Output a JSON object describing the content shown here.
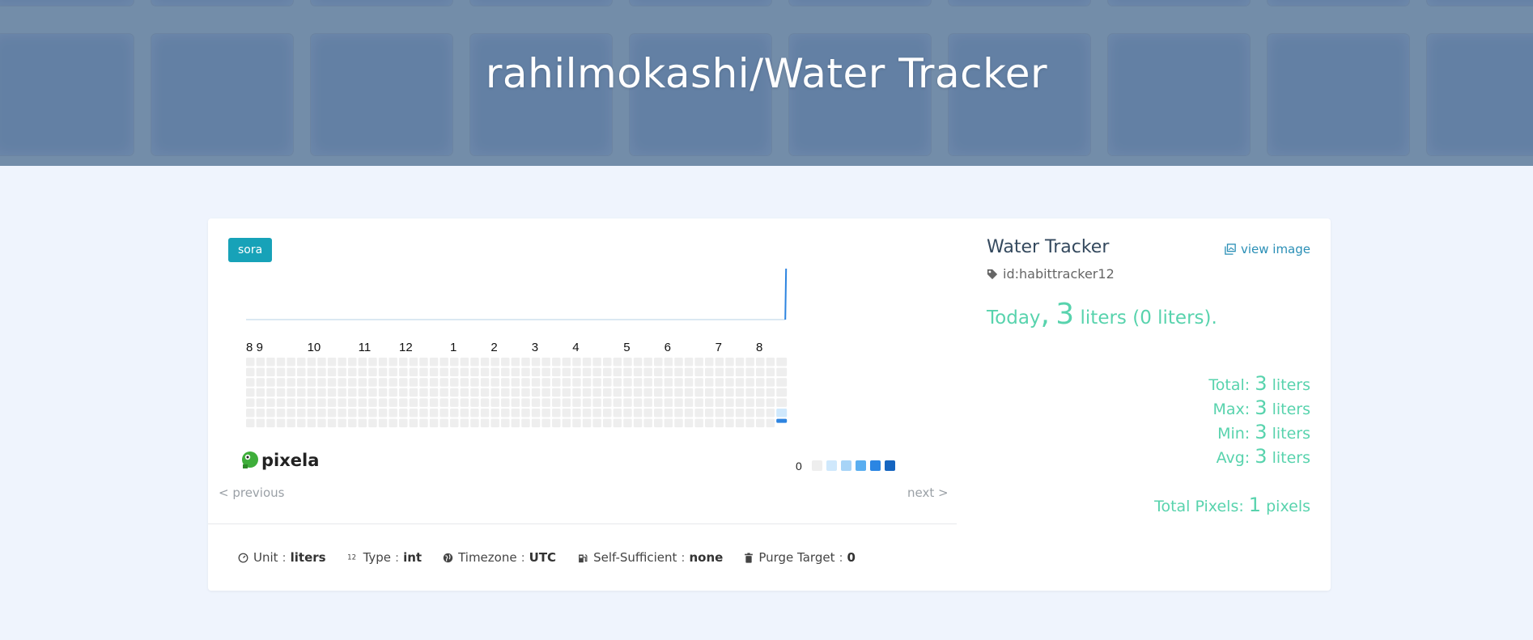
{
  "header": {
    "title": "rahilmokashi/Water Tracker"
  },
  "graph": {
    "badge": "sora",
    "name": "Water Tracker",
    "id_label": "id:habittracker12",
    "view_image_label": "view image",
    "logo_text": "pixela",
    "pager": {
      "previous": "< previous",
      "next": "next >"
    }
  },
  "chart_data": {
    "type": "heatmap",
    "month_labels": [
      "8",
      "9",
      "10",
      "11",
      "12",
      "1",
      "2",
      "3",
      "4",
      "5",
      "6",
      "7",
      "8"
    ],
    "rows": 7,
    "legend": {
      "min_label": "0",
      "max_label": "+"
    },
    "pixels": [
      {
        "week_from_end": 0,
        "day": 6,
        "value": 3
      }
    ],
    "recent_level_in_last_week": {
      "day_5": "light",
      "day_6": "dark"
    },
    "colors": {
      "empty": "#eeeeee",
      "levels": [
        "#cfe8fc",
        "#a7d4f7",
        "#5aaef0",
        "#2b86e3",
        "#1565c0"
      ],
      "line": "#cfe0ee",
      "spike": "#2d84e0"
    }
  },
  "summary": {
    "today_prefix": "Today",
    "today_comma": ",",
    "today_value": "3",
    "today_suffix": "liters (0 liters).",
    "total_label": "Total:",
    "total_value": "3",
    "total_unit": "liters",
    "max_label": "Max:",
    "max_value": "3",
    "max_unit": "liters",
    "min_label": "Min:",
    "min_value": "3",
    "min_unit": "liters",
    "avg_label": "Avg:",
    "avg_value": "3",
    "avg_unit": "liters",
    "pixels_label": "Total Pixels:",
    "pixels_value": "1",
    "pixels_unit": "pixels"
  },
  "properties": {
    "unit_label": "Unit",
    "unit_value": "liters",
    "type_label": "Type",
    "type_value": "int",
    "timezone_label": "Timezone",
    "timezone_value": "UTC",
    "self_sufficient_label": "Self-Sufficient",
    "self_sufficient_value": "none",
    "purge_label": "Purge Target",
    "purge_value": "0",
    "separator": ":"
  },
  "theme": {
    "accent": "#58d3ad",
    "badge": "#17a2b8",
    "link": "#2a8fb6"
  }
}
